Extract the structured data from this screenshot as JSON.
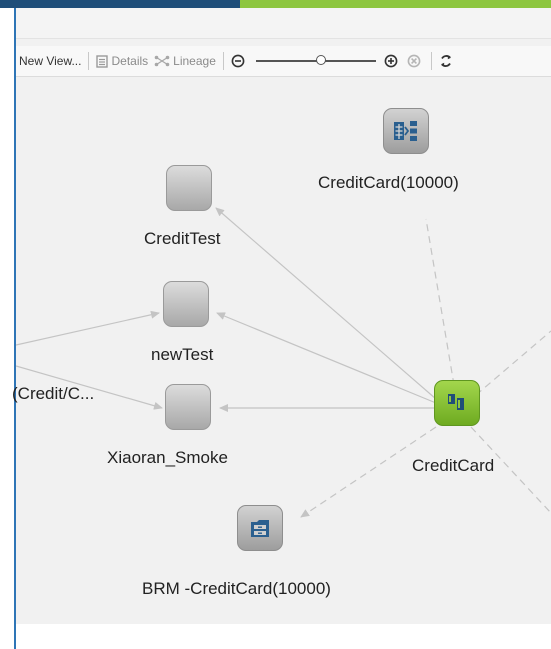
{
  "toolbar": {
    "new_view": "New View...",
    "details": "Details",
    "lineage": "Lineage",
    "zoom_level": 0.55
  },
  "graph": {
    "nodes": {
      "credit_test": "CreditTest",
      "new_test": "newTest",
      "xiaoran_smoke": "Xiaoran_Smoke",
      "creditcard_10000": "CreditCard(10000)",
      "creditcard_center": "CreditCard",
      "brm_creditcard": "BRM -CreditCard(10000)",
      "credit_cut": "(Credit/C..."
    }
  },
  "colors": {
    "brand_dark": "#1f4e79",
    "brand_green": "#8dc63f",
    "node_selected": "#8dc63f",
    "edge": "#c4c4c4",
    "icon_blue": "#2a5f8f"
  }
}
